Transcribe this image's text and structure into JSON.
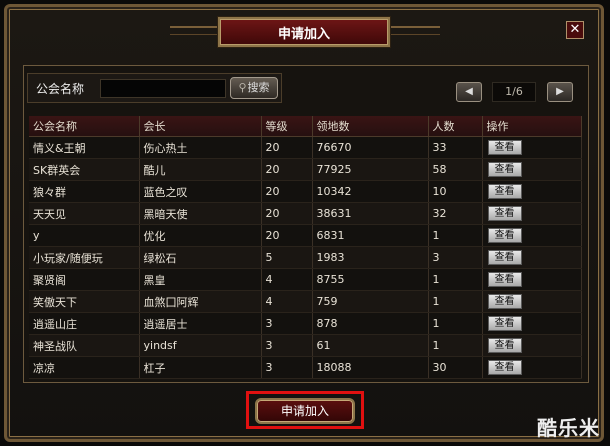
{
  "dialog": {
    "title": "申请加入",
    "close_label": "✕"
  },
  "search": {
    "label": "公会名称",
    "value": "",
    "placeholder": "",
    "button_label": "搜索",
    "icon": "magnifier-icon"
  },
  "pagination": {
    "prev_label": "◀",
    "next_label": "▶",
    "page": "1/6"
  },
  "table": {
    "headers": [
      "公会名称",
      "会长",
      "等级",
      "领地数",
      "人数",
      "操作"
    ],
    "rows": [
      {
        "guild": "情义&王朝",
        "leader": "伤心热土",
        "level": "20",
        "territory": "76670",
        "members": "33",
        "action": "查看"
      },
      {
        "guild": "SK群英会",
        "leader": "酷儿",
        "level": "20",
        "territory": "77925",
        "members": "58",
        "action": "查看"
      },
      {
        "guild": "狼々群",
        "leader": "蓝色之叹",
        "level": "20",
        "territory": "10342",
        "members": "10",
        "action": "查看"
      },
      {
        "guild": "天天见",
        "leader": "黑暗天使",
        "level": "20",
        "territory": "38631",
        "members": "32",
        "action": "查看"
      },
      {
        "guild": "y",
        "leader": "优化",
        "level": "20",
        "territory": "6831",
        "members": "1",
        "action": "查看"
      },
      {
        "guild": "小玩家/随便玩",
        "leader": "绿松石",
        "level": "5",
        "territory": "1983",
        "members": "3",
        "action": "查看"
      },
      {
        "guild": "聚贤阁",
        "leader": "黑皇",
        "level": "4",
        "territory": "8755",
        "members": "1",
        "action": "查看"
      },
      {
        "guild": "笑傲天下",
        "leader": "血煞囗阿辉",
        "level": "4",
        "territory": "759",
        "members": "1",
        "action": "查看"
      },
      {
        "guild": "逍遥山庄",
        "leader": "逍遥居士",
        "level": "3",
        "territory": "878",
        "members": "1",
        "action": "查看"
      },
      {
        "guild": "神圣战队",
        "leader": "yindsf",
        "level": "3",
        "territory": "61",
        "members": "1",
        "action": "查看"
      },
      {
        "guild": "凉凉",
        "leader": "杠子",
        "level": "3",
        "territory": "18088",
        "members": "30",
        "action": "查看"
      }
    ]
  },
  "footer": {
    "apply_label": "申请加入"
  },
  "watermark": "酷乐米",
  "colors": {
    "title_bg": "#5a0f0f",
    "frame": "#8a6f45",
    "highlight": "#e01010",
    "header_bg": "#351212"
  }
}
